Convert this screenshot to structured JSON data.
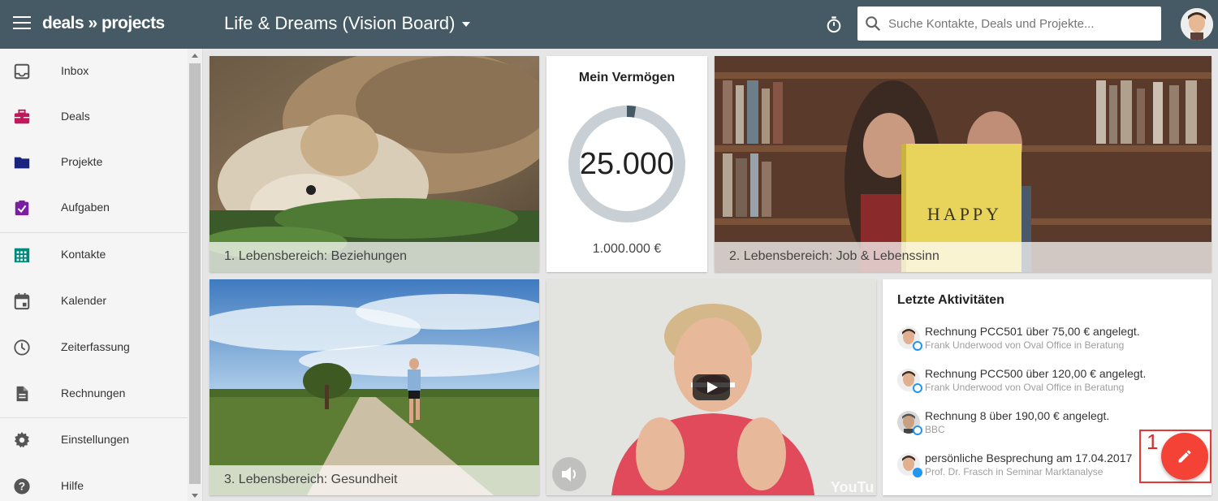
{
  "app": {
    "logo": "deals » projects",
    "board_title": "Life & Dreams (Vision Board)"
  },
  "search": {
    "placeholder": "Suche Kontakte, Deals und Projekte..."
  },
  "colors": {
    "topbar": "#455a64",
    "accent": "#f44336",
    "deals": "#c2185b",
    "projects": "#1a237e",
    "tasks": "#7b1fa2",
    "contacts": "#00897b"
  },
  "sidebar": {
    "items": [
      {
        "label": "Inbox",
        "icon": "inbox-icon"
      },
      {
        "label": "Deals",
        "icon": "briefcase-icon"
      },
      {
        "label": "Projekte",
        "icon": "folder-icon"
      },
      {
        "label": "Aufgaben",
        "icon": "clipboard-check-icon"
      },
      {
        "label": "Kontakte",
        "icon": "contacts-grid-icon"
      },
      {
        "label": "Kalender",
        "icon": "calendar-icon"
      },
      {
        "label": "Zeiterfassung",
        "icon": "clock-icon"
      },
      {
        "label": "Rechnungen",
        "icon": "document-icon"
      },
      {
        "label": "Einstellungen",
        "icon": "gear-icon"
      },
      {
        "label": "Hilfe",
        "icon": "help-icon"
      }
    ]
  },
  "cards": {
    "relationships": {
      "caption": "1. Lebensbereich: Beziehungen"
    },
    "job": {
      "caption": "2. Lebensbereich: Job & Lebenssinn",
      "book_text": "HAPPY"
    },
    "health": {
      "caption": "3. Lebensbereich: Gesundheit"
    },
    "wealth": {
      "title": "Mein Vermögen",
      "value": "25.000",
      "target": "1.000.000 €",
      "progress": 0.025
    },
    "video": {
      "watermark": "YouTu"
    },
    "activities": {
      "title": "Letzte Aktivitäten",
      "items": [
        {
          "title": "Rechnung PCC501 über 75,00 € angelegt.",
          "subtitle": "Frank Underwood von Oval Office in Beratung"
        },
        {
          "title": "Rechnung PCC500 über 120,00 € angelegt.",
          "subtitle": "Frank Underwood von Oval Office in Beratung"
        },
        {
          "title": "Rechnung 8 über 190,00 € angelegt.",
          "subtitle": "BBC"
        },
        {
          "title": "persönliche Besprechung am 17.04.2017",
          "subtitle": "Prof. Dr. Frasch in Seminar Marktanalyse"
        }
      ]
    }
  },
  "annotation": {
    "number": "1"
  }
}
